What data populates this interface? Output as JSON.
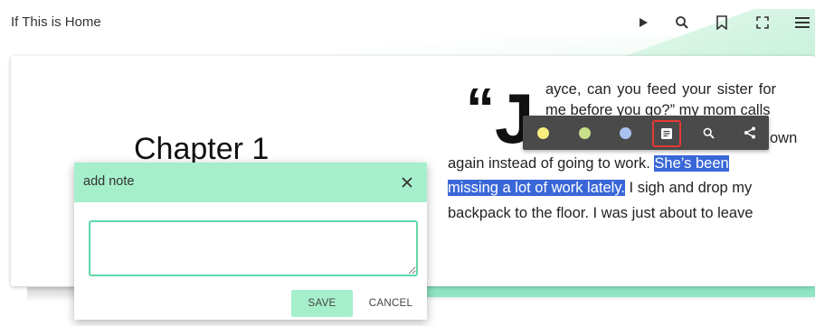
{
  "header": {
    "title": "If This is Home",
    "icons": [
      "play-icon",
      "search-icon",
      "bookmark-icon",
      "fullscreen-icon",
      "menu-icon"
    ]
  },
  "page": {
    "chapter_title": "Chapter 1",
    "dropcap_quote": "“",
    "dropcap_letter": "J",
    "lines": [
      "ayce, can you feed your sister for",
      "me before you go?” my mom calls",
      "own",
      "again instead of going to work.",
      "She’s been",
      "missing a lot of work lately.",
      "I sigh and drop my",
      "backpack to the floor. I was just about to leave"
    ]
  },
  "selection_toolbar": {
    "colors": [
      "#f7ee7e",
      "#c8e08a",
      "#a9c3ee"
    ],
    "icons": [
      "note-icon",
      "search-icon",
      "share-icon"
    ]
  },
  "note_dialog": {
    "title": "add note",
    "textarea_value": "",
    "save_label": "SAVE",
    "cancel_label": "CANCEL"
  }
}
